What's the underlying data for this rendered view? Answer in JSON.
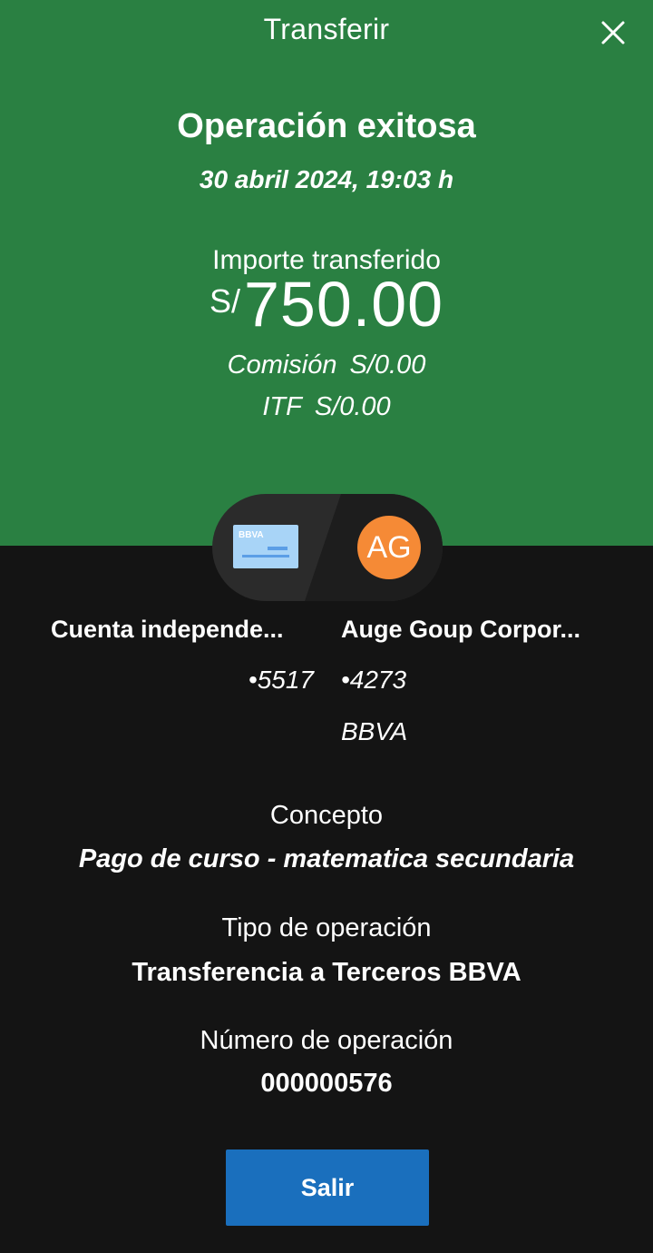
{
  "header": {
    "title": "Transferir",
    "close_icon": "close-icon"
  },
  "status": {
    "title": "Operación exitosa",
    "datetime": "30 abril 2024, 19:03 h"
  },
  "amount": {
    "label": "Importe transferido",
    "currency": "S/",
    "value": "750.00",
    "commission_label": "Comisión",
    "commission_value": "S/0.00",
    "itf_label": "ITF",
    "itf_value": "S/0.00"
  },
  "transfer": {
    "source": {
      "name": "Cuenta independe...",
      "number": "•5517",
      "icon": "bbva-card-icon",
      "card_brand": "BBVA"
    },
    "destination": {
      "initials": "AG",
      "name": "Auge Goup Corpor...",
      "number": "•4273",
      "bank": "BBVA"
    }
  },
  "details": {
    "concept_label": "Concepto",
    "concept_value": "Pago de curso - matematica secundaria",
    "type_label": "Tipo de operación",
    "type_value": "Transferencia a Terceros BBVA",
    "number_label": "Número de operación",
    "number_value": "000000576"
  },
  "actions": {
    "exit_label": "Salir"
  },
  "colors": {
    "success_green": "#2a8042",
    "background_dark": "#141414",
    "pill_dark": "#2b2b2b",
    "avatar_orange": "#f58a36",
    "button_blue": "#1a6fbd",
    "card_light_blue": "#a8d4f7"
  }
}
